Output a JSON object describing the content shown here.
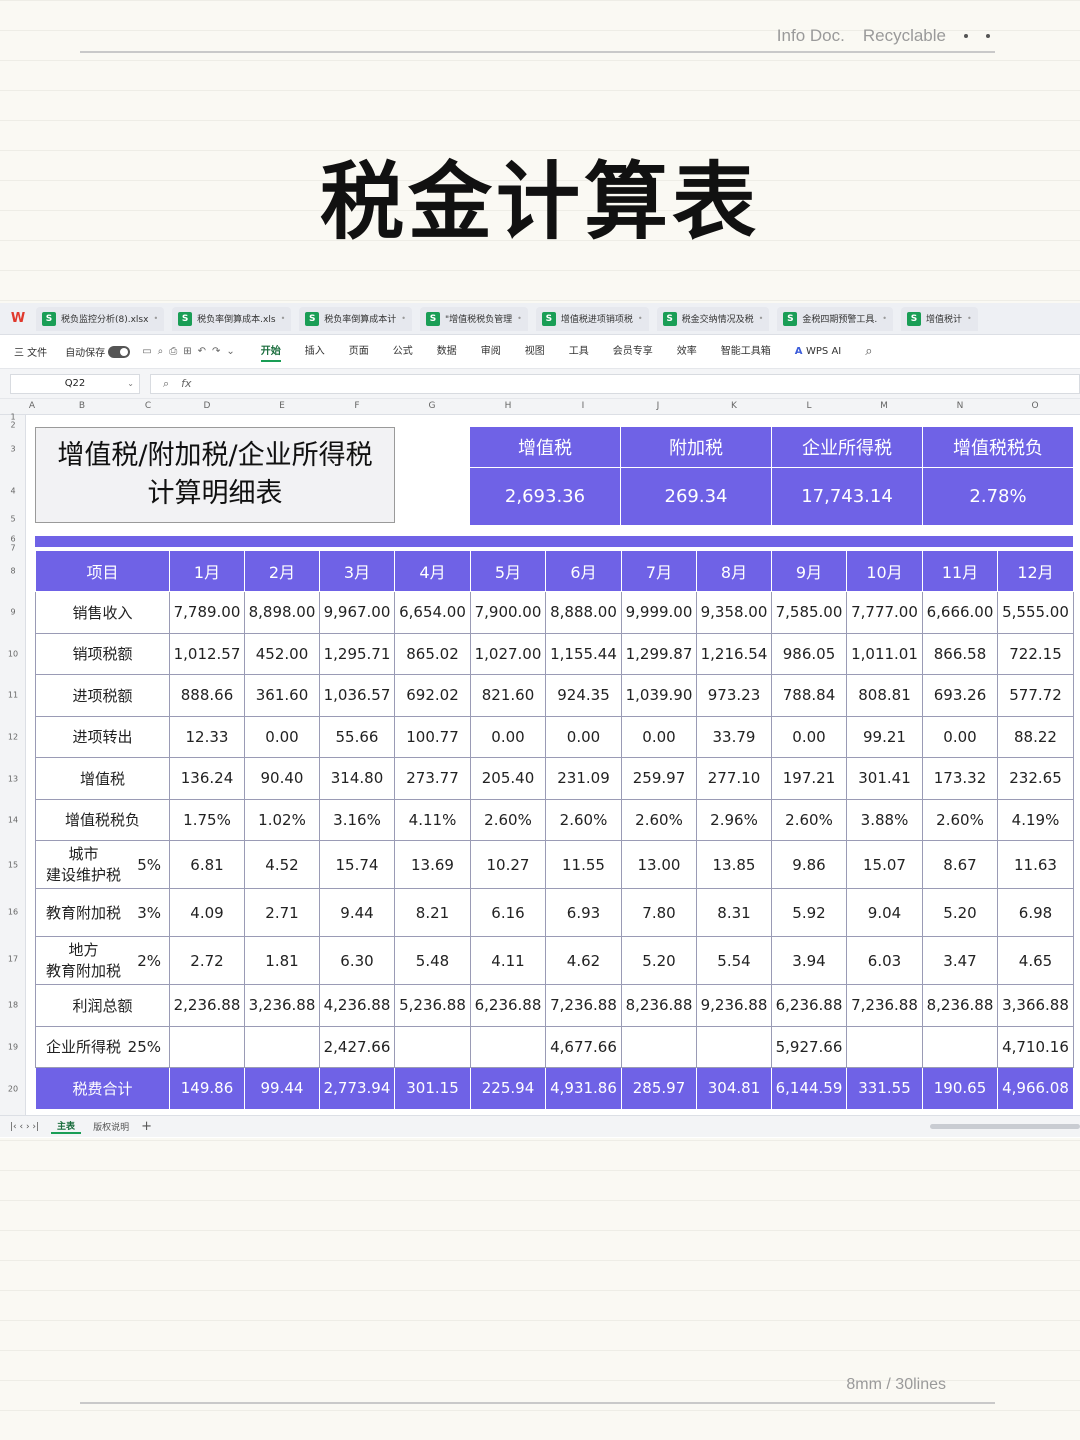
{
  "paper": {
    "header_left": "Info Doc.",
    "header_right": "Recyclable",
    "footer": "8mm / 30lines"
  },
  "page_title": "税金计算表",
  "app": {
    "file_tabs": [
      "税负监控分析(8).xlsx",
      "税负率倒算成本.xls",
      "税负率倒算成本计",
      "\"增值税税负管理",
      "增值税进项销项税",
      "税金交纳情况及税",
      "金税四期预警工具.",
      "增值税计"
    ],
    "menu": {
      "file": "三 文件",
      "autosave": "自动保存",
      "items": [
        "开始",
        "插入",
        "页面",
        "公式",
        "数据",
        "审阅",
        "视图",
        "工具",
        "会员专享",
        "效率",
        "智能工具箱"
      ],
      "active": "开始",
      "ai": "WPS AI"
    },
    "cell_ref": "Q22",
    "fx": "fx",
    "columns": [
      "A",
      "B",
      "C",
      "D",
      "E",
      "F",
      "G",
      "H",
      "I",
      "J",
      "K",
      "L",
      "M",
      "N",
      "O"
    ],
    "rows": [
      "1",
      "2",
      "3",
      "4",
      "5",
      "6",
      "7",
      "8",
      "9",
      "10",
      "11",
      "12",
      "13",
      "14",
      "15",
      "16",
      "17",
      "18",
      "19",
      "20"
    ],
    "sheet_tabs": [
      "主表",
      "版权说明"
    ],
    "active_sheet": "主表"
  },
  "sheet": {
    "title_line1": "增值税/附加税/企业所得税",
    "title_line2": "计算明细表",
    "summary": {
      "headers": [
        "增值税",
        "附加税",
        "企业所得税",
        "增值税税负"
      ],
      "values": [
        "2,693.36",
        "269.34",
        "17,743.14",
        "2.78%"
      ]
    },
    "months": [
      "1月",
      "2月",
      "3月",
      "4月",
      "5月",
      "6月",
      "7月",
      "8月",
      "9月",
      "10月",
      "11月",
      "12月"
    ],
    "header_item": "项目",
    "rows": [
      {
        "label": "销售收入",
        "values": [
          "7,789.00",
          "8,898.00",
          "9,967.00",
          "6,654.00",
          "7,900.00",
          "8,888.00",
          "9,999.00",
          "9,358.00",
          "7,585.00",
          "7,777.00",
          "6,666.00",
          "5,555.00"
        ]
      },
      {
        "label": "销项税额",
        "values": [
          "1,012.57",
          "452.00",
          "1,295.71",
          "865.02",
          "1,027.00",
          "1,155.44",
          "1,299.87",
          "1,216.54",
          "986.05",
          "1,011.01",
          "866.58",
          "722.15"
        ]
      },
      {
        "label": "进项税额",
        "values": [
          "888.66",
          "361.60",
          "1,036.57",
          "692.02",
          "821.60",
          "924.35",
          "1,039.90",
          "973.23",
          "788.84",
          "808.81",
          "693.26",
          "577.72"
        ]
      },
      {
        "label": "进项转出",
        "values": [
          "12.33",
          "0.00",
          "55.66",
          "100.77",
          "0.00",
          "0.00",
          "0.00",
          "33.79",
          "0.00",
          "99.21",
          "0.00",
          "88.22"
        ]
      },
      {
        "label": "增值税",
        "values": [
          "136.24",
          "90.40",
          "314.80",
          "273.77",
          "205.40",
          "231.09",
          "259.97",
          "277.10",
          "197.21",
          "301.41",
          "173.32",
          "232.65"
        ]
      },
      {
        "label": "增值税税负",
        "values": [
          "1.75%",
          "1.02%",
          "3.16%",
          "4.11%",
          "2.60%",
          "2.60%",
          "2.60%",
          "2.96%",
          "2.60%",
          "3.88%",
          "2.60%",
          "4.19%"
        ]
      }
    ],
    "city_tax": {
      "line1": "城市",
      "line2": "建设维护税",
      "rate": "5%",
      "values": [
        "6.81",
        "4.52",
        "15.74",
        "13.69",
        "10.27",
        "11.55",
        "13.00",
        "13.85",
        "9.86",
        "15.07",
        "8.67",
        "11.63"
      ]
    },
    "edu_tax": {
      "label": "教育附加税",
      "rate": "3%",
      "values": [
        "4.09",
        "2.71",
        "9.44",
        "8.21",
        "6.16",
        "6.93",
        "7.80",
        "8.31",
        "5.92",
        "9.04",
        "5.20",
        "6.98"
      ]
    },
    "local_edu_tax": {
      "line1": "地方",
      "line2": "教育附加税",
      "rate": "2%",
      "values": [
        "2.72",
        "1.81",
        "6.30",
        "5.48",
        "4.11",
        "4.62",
        "5.20",
        "5.54",
        "3.94",
        "6.03",
        "3.47",
        "4.65"
      ]
    },
    "profit": {
      "label": "利润总额",
      "values": [
        "2,236.88",
        "3,236.88",
        "4,236.88",
        "5,236.88",
        "6,236.88",
        "7,236.88",
        "8,236.88",
        "9,236.88",
        "6,236.88",
        "7,236.88",
        "8,236.88",
        "3,366.88"
      ]
    },
    "income_tax": {
      "label": "企业所得税",
      "rate": "25%",
      "values": [
        "",
        "",
        "2,427.66",
        "",
        "",
        "4,677.66",
        "",
        "",
        "5,927.66",
        "",
        "",
        "4,710.16"
      ]
    },
    "total": {
      "label": "税费合计",
      "values": [
        "149.86",
        "99.44",
        "2,773.94",
        "301.15",
        "225.94",
        "4,931.86",
        "285.97",
        "304.81",
        "6,144.59",
        "331.55",
        "190.65",
        "4,966.08"
      ]
    }
  }
}
